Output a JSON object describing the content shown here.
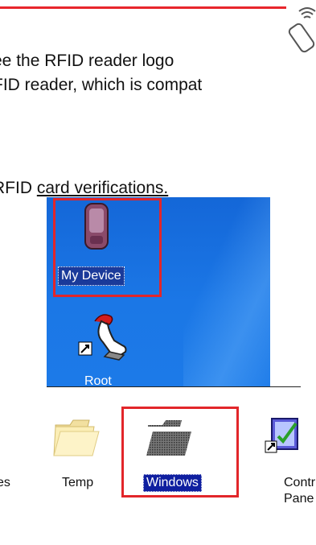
{
  "document": {
    "line1": "ee the RFID reader logo",
    "line2": "FID reader, which is compat",
    "line3_prefix": "RFID ",
    "line3_underlined": "card verifications."
  },
  "icons": {
    "rfid_logo": "rfid-reader-icon",
    "my_device": "mobile-device-icon",
    "root": "root-shortcut-icon",
    "folder": "folder-icon",
    "control_panel": "control-panel-icon"
  },
  "desktop": {
    "my_device_label": "My Device",
    "root_label": "Root"
  },
  "explorer": {
    "items": [
      {
        "label": "es"
      },
      {
        "label": "Temp"
      },
      {
        "label": "Windows"
      },
      {
        "label": "Contr",
        "label2": "Pane"
      }
    ]
  },
  "colors": {
    "highlight_red": "#e2262a",
    "desktop_blue": "#1b77e6",
    "selection_blue": "#0f1fa0"
  }
}
